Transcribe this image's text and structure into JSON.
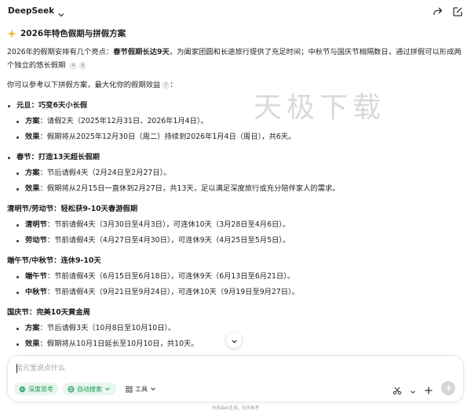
{
  "header": {
    "model_name": "DeepSeek"
  },
  "title": "2026年特色假期与拼假方案",
  "intro": {
    "part1": "2026年的假期安排有几个亮点：",
    "bold": "春节假期长达9天",
    "part2": "，为阖家团圆和长途旅行提供了充足时间；中秋节与国庆节相隔数日，通过拼假可以形成两个独立的悠长假期",
    "cites": [
      "4",
      "6"
    ]
  },
  "lead": {
    "text": "你可以参考以下拼假方案，最大化你的假期效益",
    "cite": "7"
  },
  "sections": [
    {
      "head": "元旦：巧变6天小长假",
      "items": [
        {
          "key": "方案",
          "text": "：请假2天（2025年12月31日、2026年1月4日）。"
        },
        {
          "key": "效果",
          "text": "：假期将从2025年12月30日（周二）持续到2026年1月4日（周日），共6天。"
        }
      ]
    },
    {
      "head": "春节：打造13天超长假期",
      "items": [
        {
          "key": "方案",
          "text": "：节后请假4天（2月24日至2月27日）。"
        },
        {
          "key": "效果",
          "text": "：假期将从2月15日一直休到2月27日，共13天，足以满足深度旅行或充分陪伴家人的需求。"
        }
      ]
    },
    {
      "head": "清明节/劳动节：轻松获9-10天春游假期",
      "items": [
        {
          "key": "清明节",
          "text": "：节前请假4天（3月30日至4月3日），可连休10天（3月28日至4月6日）。"
        },
        {
          "key": "劳动节",
          "text": "：节前请假4天（4月27日至4月30日），可连休9天（4月25日至5月5日）。"
        }
      ]
    },
    {
      "head": "端午节/中秋节：连休9-10天",
      "items": [
        {
          "key": "端午节",
          "text": "：节前请假4天（6月15日至6月18日），可连休9天（6月13日至6月21日）。"
        },
        {
          "key": "中秋节",
          "text": "：节前请假4天（9月21日至9月24日），可连休10天（9月19日至9月27日）。"
        }
      ]
    },
    {
      "head": "国庆节：完美10天黄金周",
      "items": [
        {
          "key": "方案",
          "text": "：节后请假3天（10月8日至10月10日）。"
        },
        {
          "key": "效果",
          "text": "：假期将从10月1日延长至10月10日，共10天。"
        }
      ]
    }
  ],
  "watermark": "天极下载",
  "composer": {
    "placeholder": "给元宝说点什么",
    "chip_deep": "深度思考",
    "chip_search": "自动搜索",
    "chip_tools": "工具"
  },
  "footer": "内容由AI生成，仅供参考",
  "colors": {
    "accent_green": "#1a9954",
    "chip_bg": "#e8f6ee"
  }
}
